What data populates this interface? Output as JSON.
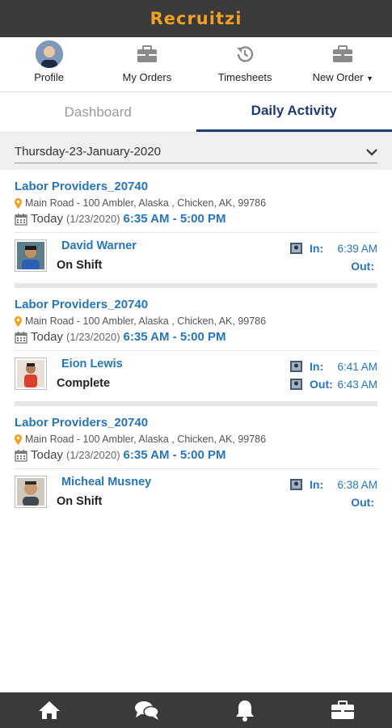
{
  "app": {
    "brand": "Recruitzi",
    "brand_color": "#f2a01f",
    "accent": "#2776b9",
    "header_bg": "#3a3a3a"
  },
  "topnav": {
    "items": [
      {
        "label": "Profile",
        "icon": "avatar"
      },
      {
        "label": "My Orders",
        "icon": "briefcase-icon"
      },
      {
        "label": "Timesheets",
        "icon": "history-icon"
      },
      {
        "label": "New Order",
        "icon": "briefcase-icon"
      }
    ]
  },
  "tabs": [
    {
      "label": "Dashboard",
      "active": false
    },
    {
      "label": "Daily Activity",
      "active": true
    }
  ],
  "date_selector": {
    "value": "Thursday-23-January-2020"
  },
  "cards": [
    {
      "title": "Labor Providers_20740",
      "address": "Main Road - 100 Ambler, Alaska , Chicken, AK, 99786",
      "day": "Today",
      "date": "(1/23/2020)",
      "range": "6:35 AM - 5:00 PM",
      "worker": {
        "name": "David Warner",
        "status": "On Shift"
      },
      "in_label": "In:",
      "in_time": "6:39 AM",
      "out_label": "Out:",
      "out_time": ""
    },
    {
      "title": "Labor Providers_20740",
      "address": "Main Road - 100 Ambler, Alaska , Chicken, AK, 99786",
      "day": "Today",
      "date": "(1/23/2020)",
      "range": "6:35 AM - 5:00 PM",
      "worker": {
        "name": "Eion Lewis",
        "status": "Complete"
      },
      "in_label": "In:",
      "in_time": "6:41 AM",
      "out_label": "Out:",
      "out_time": "6:43 AM"
    },
    {
      "title": "Labor Providers_20740",
      "address": "Main Road - 100 Ambler, Alaska , Chicken, AK, 99786",
      "day": "Today",
      "date": "(1/23/2020)",
      "range": "6:35 AM - 5:00 PM",
      "worker": {
        "name": "Micheal Musney",
        "status": "On Shift"
      },
      "in_label": "In:",
      "in_time": "6:38 AM",
      "out_label": "Out:",
      "out_time": ""
    }
  ],
  "bottom_nav": [
    {
      "icon": "home-icon"
    },
    {
      "icon": "chat-icon"
    },
    {
      "icon": "bell-icon"
    },
    {
      "icon": "briefcase-icon"
    }
  ]
}
